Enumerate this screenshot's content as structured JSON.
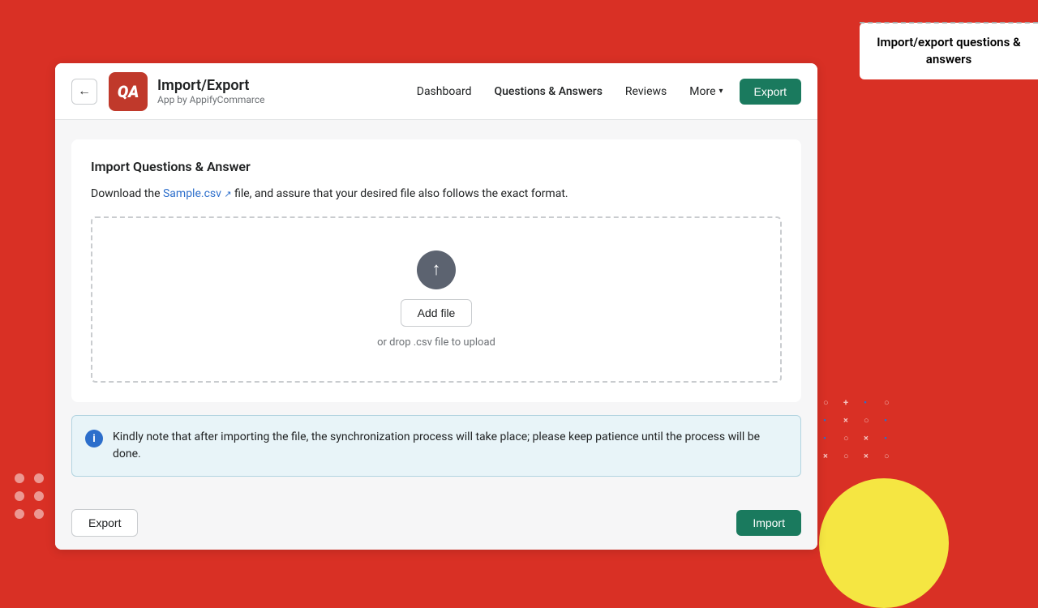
{
  "background": {
    "color": "#d93025"
  },
  "tooltip": {
    "text": "Import/export questions & answers"
  },
  "header": {
    "back_label": "←",
    "app_logo_text": "QA",
    "app_title": "Import/Export",
    "app_subtitle": "App by AppifyCommarce",
    "nav": [
      {
        "label": "Dashboard",
        "active": false
      },
      {
        "label": "Questions & Answers",
        "active": true
      },
      {
        "label": "Reviews",
        "active": false
      },
      {
        "label": "More",
        "active": false
      }
    ],
    "export_button": "Export"
  },
  "main": {
    "section_title": "Import Questions & Answer",
    "instruction_prefix": "Download the ",
    "sample_link": "Sample.csv",
    "instruction_suffix": " file, and assure that your desired file also follows the exact format.",
    "dropzone": {
      "button_label": "Add file",
      "hint": "or drop .csv file to upload"
    },
    "info_message": "Kindly note that after importing the file, the synchronization process will take place; please keep patience until the process will be done."
  },
  "footer": {
    "export_label": "Export",
    "import_label": "Import"
  }
}
